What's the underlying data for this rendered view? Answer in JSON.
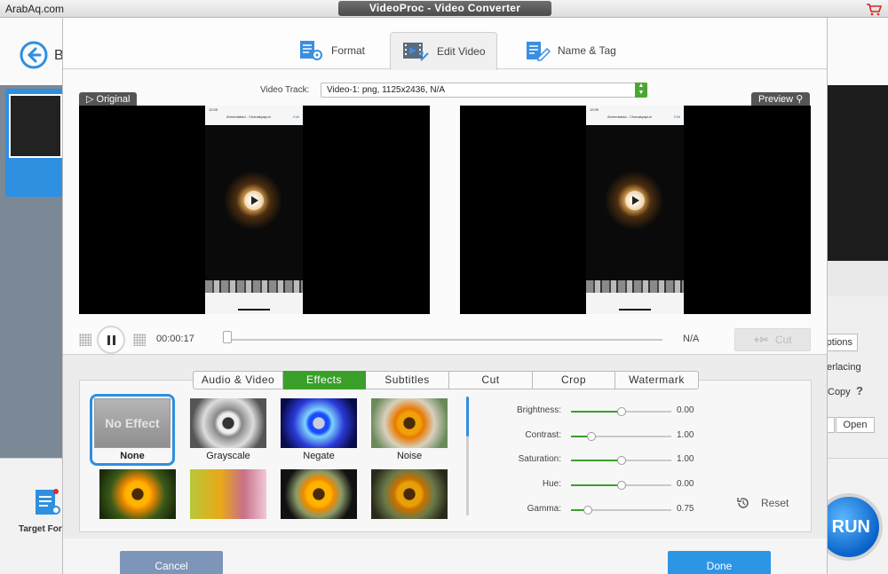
{
  "watermark": "ArabAq.com",
  "window": {
    "title": "VideoProc - Video Converter"
  },
  "background": {
    "back_letter": "B",
    "target_format_label": "Target For",
    "right_panel": {
      "options": "ptions",
      "deinterlacing": "terlacing",
      "copy": "Copy",
      "help": "?",
      "open": "Open"
    },
    "run_label": "RUN"
  },
  "tabs": [
    {
      "label": "Format",
      "icon": "format-icon",
      "active": false
    },
    {
      "label": "Edit Video",
      "icon": "film-edit-icon",
      "active": true
    },
    {
      "label": "Name & Tag",
      "icon": "tag-edit-icon",
      "active": false
    }
  ],
  "video_track": {
    "label": "Video Track:",
    "value": "Video-1: png, 1125x2436, N/A"
  },
  "preview": {
    "original_tag": "Original",
    "preview_tag": "Preview",
    "phone_time": "12:09",
    "phone_header": "Ahmedabad - Chanakyapuri",
    "phone_edit": "Edit"
  },
  "playback": {
    "time": "00:00:17",
    "duration": "N/A",
    "progress": 0,
    "cut_label": "Cut"
  },
  "subtabs": [
    {
      "label": "Audio & Video",
      "active": false
    },
    {
      "label": "Effects",
      "active": true
    },
    {
      "label": "Subtitles",
      "active": false
    },
    {
      "label": "Cut",
      "active": false
    },
    {
      "label": "Crop",
      "active": false
    },
    {
      "label": "Watermark",
      "active": false
    }
  ],
  "effects": {
    "no_effect_text": "No Effect",
    "items": [
      {
        "label": "None",
        "selected": true
      },
      {
        "label": "Grayscale",
        "selected": false
      },
      {
        "label": "Negate",
        "selected": false
      },
      {
        "label": "Noise",
        "selected": false
      },
      {
        "label": "",
        "selected": false
      },
      {
        "label": "",
        "selected": false
      },
      {
        "label": "",
        "selected": false
      },
      {
        "label": "",
        "selected": false
      }
    ]
  },
  "adjustments": [
    {
      "name": "Brightness:",
      "value": "0.00",
      "level": 0.5
    },
    {
      "name": "Contrast:",
      "value": "1.00",
      "level": 0.2
    },
    {
      "name": "Saturation:",
      "value": "1.00",
      "level": 0.5
    },
    {
      "name": "Hue:",
      "value": "0.00",
      "level": 0.5
    },
    {
      "name": "Gamma:",
      "value": "0.75",
      "level": 0.17
    }
  ],
  "reset_label": "Reset",
  "footer": {
    "cancel": "Cancel",
    "done": "Done"
  },
  "colors": {
    "accent_green": "#3aa02a",
    "accent_blue": "#2c95e6",
    "cancel_blue": "#7d95b8"
  }
}
